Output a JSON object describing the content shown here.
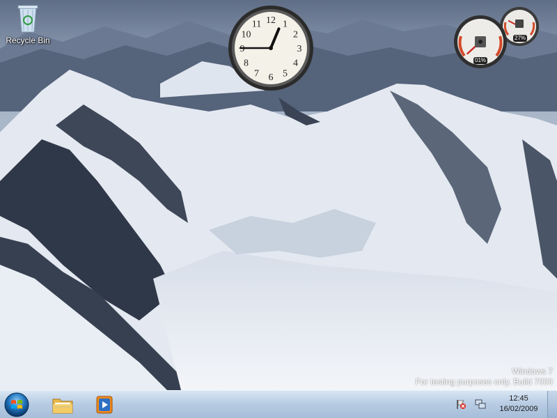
{
  "desktop": {
    "icons": [
      {
        "label": "Recycle Bin",
        "icon": "recycle-bin-icon"
      }
    ],
    "gadgets": {
      "clock": {
        "hours": 12,
        "minutes": 45,
        "numerals": [
          "12",
          "1",
          "2",
          "3",
          "4",
          "5",
          "6",
          "7",
          "8",
          "9",
          "10",
          "11"
        ]
      },
      "cpu_meter": {
        "cpu_label": "01%",
        "memory_label": "27%",
        "cpu_value": 1,
        "memory_value": 27
      }
    },
    "watermark": {
      "line1": "Windows 7",
      "line2": "For testing purposes only. Build 7000"
    }
  },
  "taskbar": {
    "start_icon": "windows-start-orb-icon",
    "pinned": [
      {
        "name": "windows-explorer",
        "icon": "folder-icon"
      },
      {
        "name": "windows-media-player",
        "icon": "media-player-icon"
      }
    ],
    "tray": {
      "icons": [
        "action-center-flag-icon",
        "network-icon"
      ],
      "time": "12:45",
      "date": "16/02/2009"
    }
  },
  "colors": {
    "taskbar": "#b9cde4",
    "sky": "#8a9bb5",
    "snow": "#eef2f8",
    "rock": "#2a3240"
  }
}
